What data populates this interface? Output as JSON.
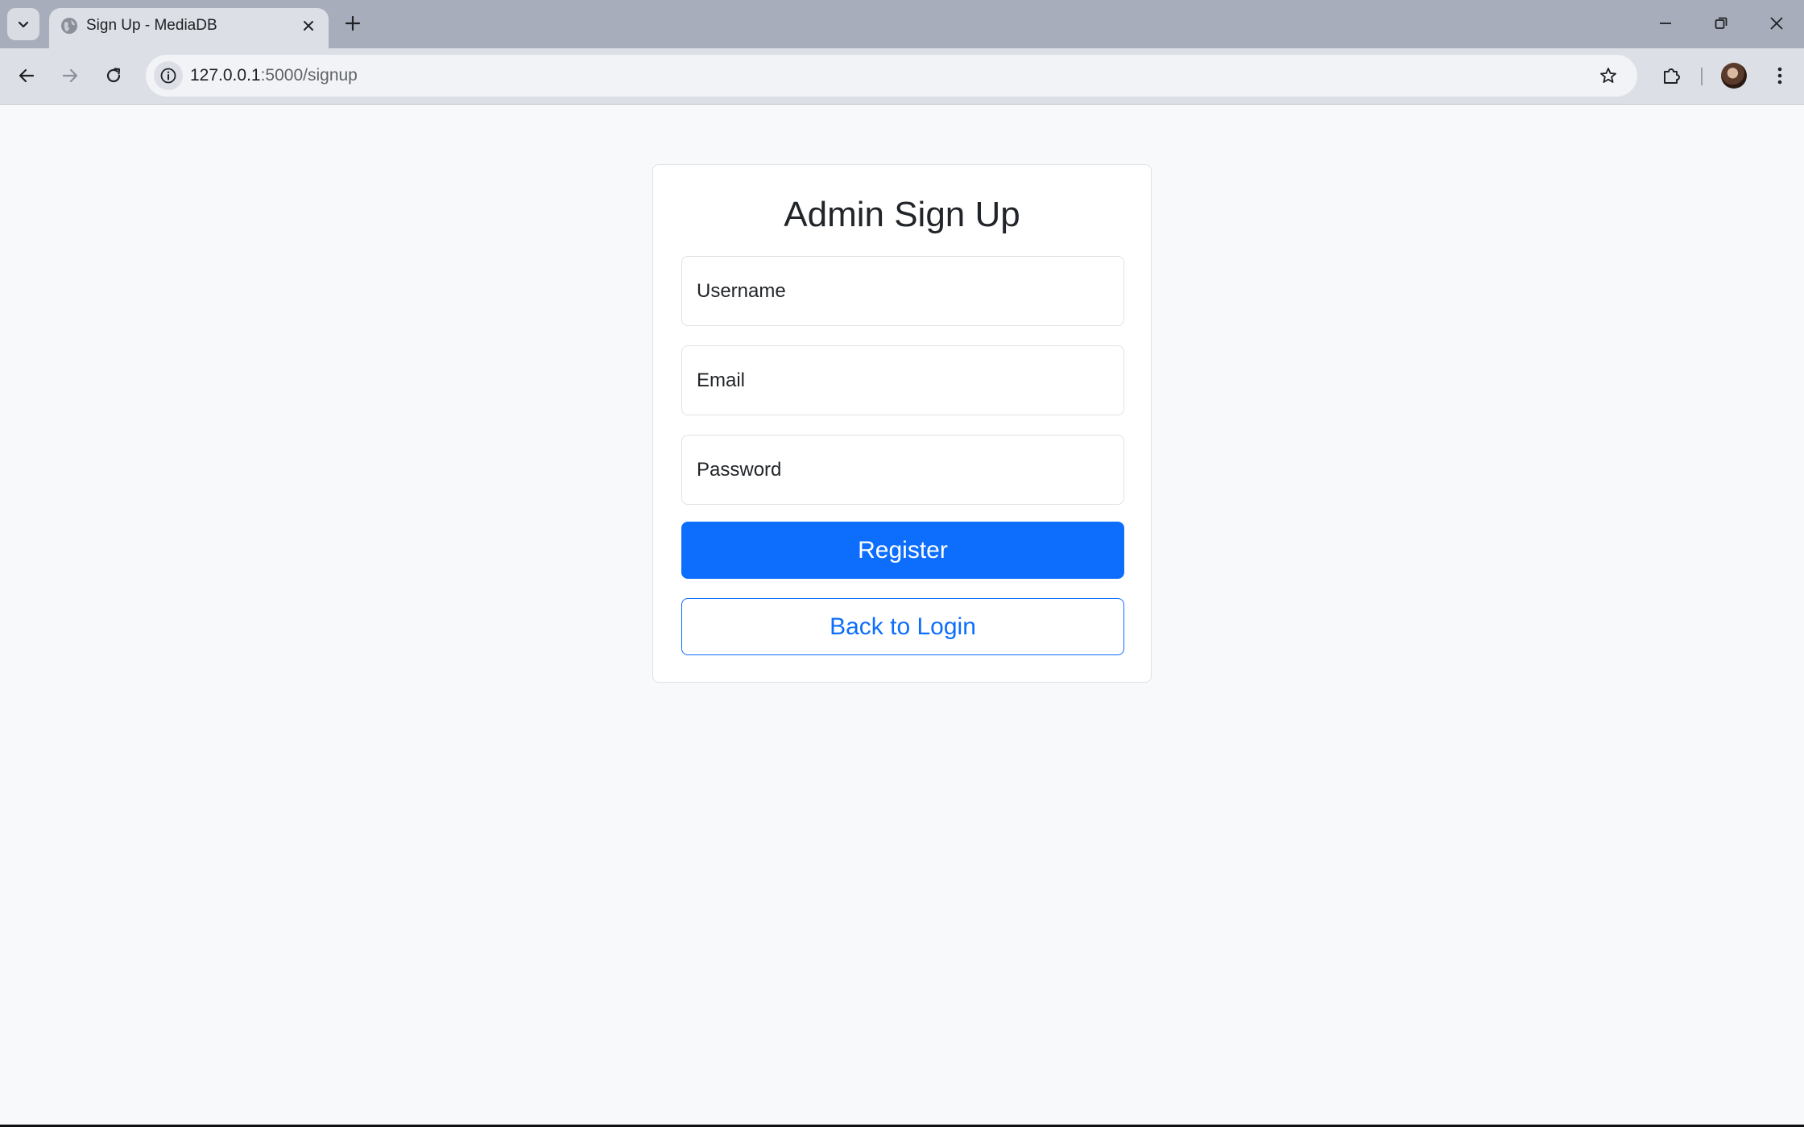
{
  "browser": {
    "tab": {
      "title": "Sign Up - MediaDB"
    },
    "address_bar": {
      "host": "127.0.0.1",
      "path": ":5000/signup"
    }
  },
  "page": {
    "title": "Admin Sign Up",
    "form": {
      "username": {
        "placeholder": "Username",
        "value": ""
      },
      "email": {
        "placeholder": "Email",
        "value": ""
      },
      "password": {
        "placeholder": "Password",
        "value": ""
      }
    },
    "register_label": "Register",
    "back_label": "Back to Login"
  },
  "colors": {
    "primary": "#0d6efd",
    "page_background": "#f8f9fa",
    "card_border": "#dee2e6",
    "text": "#212529"
  },
  "icons": [
    "tab-search-icon",
    "globe-icon",
    "close-icon",
    "plus-icon",
    "minimize-icon",
    "restore-icon",
    "window-close-icon",
    "back-arrow-icon",
    "forward-arrow-icon",
    "reload-icon",
    "info-icon",
    "star-icon",
    "puzzle-icon",
    "kebab-menu-icon"
  ]
}
